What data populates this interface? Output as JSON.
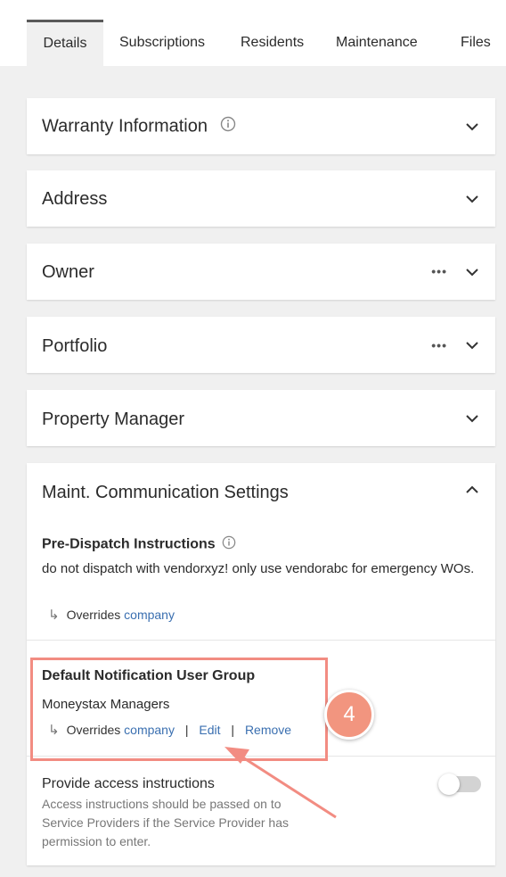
{
  "tabs": [
    "Details",
    "Subscriptions",
    "Residents",
    "Maintenance",
    "Files"
  ],
  "sections": {
    "warranty": "Warranty Information",
    "address": "Address",
    "owner": "Owner",
    "portfolio": "Portfolio",
    "property_manager": "Property Manager",
    "maint_comm": "Maint. Communication Settings"
  },
  "pre_dispatch": {
    "title": "Pre-Dispatch Instructions",
    "text": "do not dispatch with vendorxyz! only use vendorabc for emergency WOs.",
    "overrides_label": "Overrides",
    "overrides_link": "company"
  },
  "notification_group": {
    "title": "Default Notification User Group",
    "value": "Moneystax Managers",
    "overrides_label": "Overrides",
    "overrides_link": "company",
    "edit": "Edit",
    "remove": "Remove",
    "separator": "|"
  },
  "access": {
    "title": "Provide access instructions",
    "description": "Access instructions should be passed on to Service Providers if the Service Provider has permission to enter.",
    "toggle_on": false
  },
  "annotation": {
    "step_number": "4",
    "color": "#f28c82"
  }
}
